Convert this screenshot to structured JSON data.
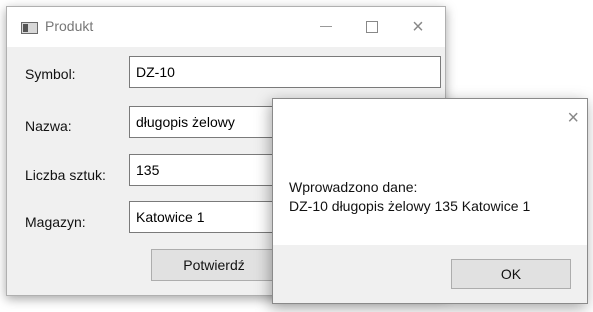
{
  "window": {
    "title": "Produkt",
    "controls": {
      "minimize": "—",
      "maximize": "□",
      "close": "×"
    }
  },
  "form": {
    "symbol_label": "Symbol:",
    "symbol_value": "DZ-10",
    "name_label": "Nazwa:",
    "name_value": "długopis żelowy",
    "qty_label": "Liczba sztuk:",
    "qty_value": "135",
    "warehouse_label": "Magazyn:",
    "warehouse_value": "Katowice 1",
    "confirm_label": "Potwierdź"
  },
  "message_box": {
    "close": "×",
    "line1": "Wprowadzono dane:",
    "line2": "DZ-10 długopis żelowy 135 Katowice 1",
    "ok_label": "OK"
  },
  "icons": {
    "app_icon": "window-app-icon",
    "minimize": "minimize-icon",
    "maximize": "maximize-icon",
    "close": "close-icon"
  }
}
